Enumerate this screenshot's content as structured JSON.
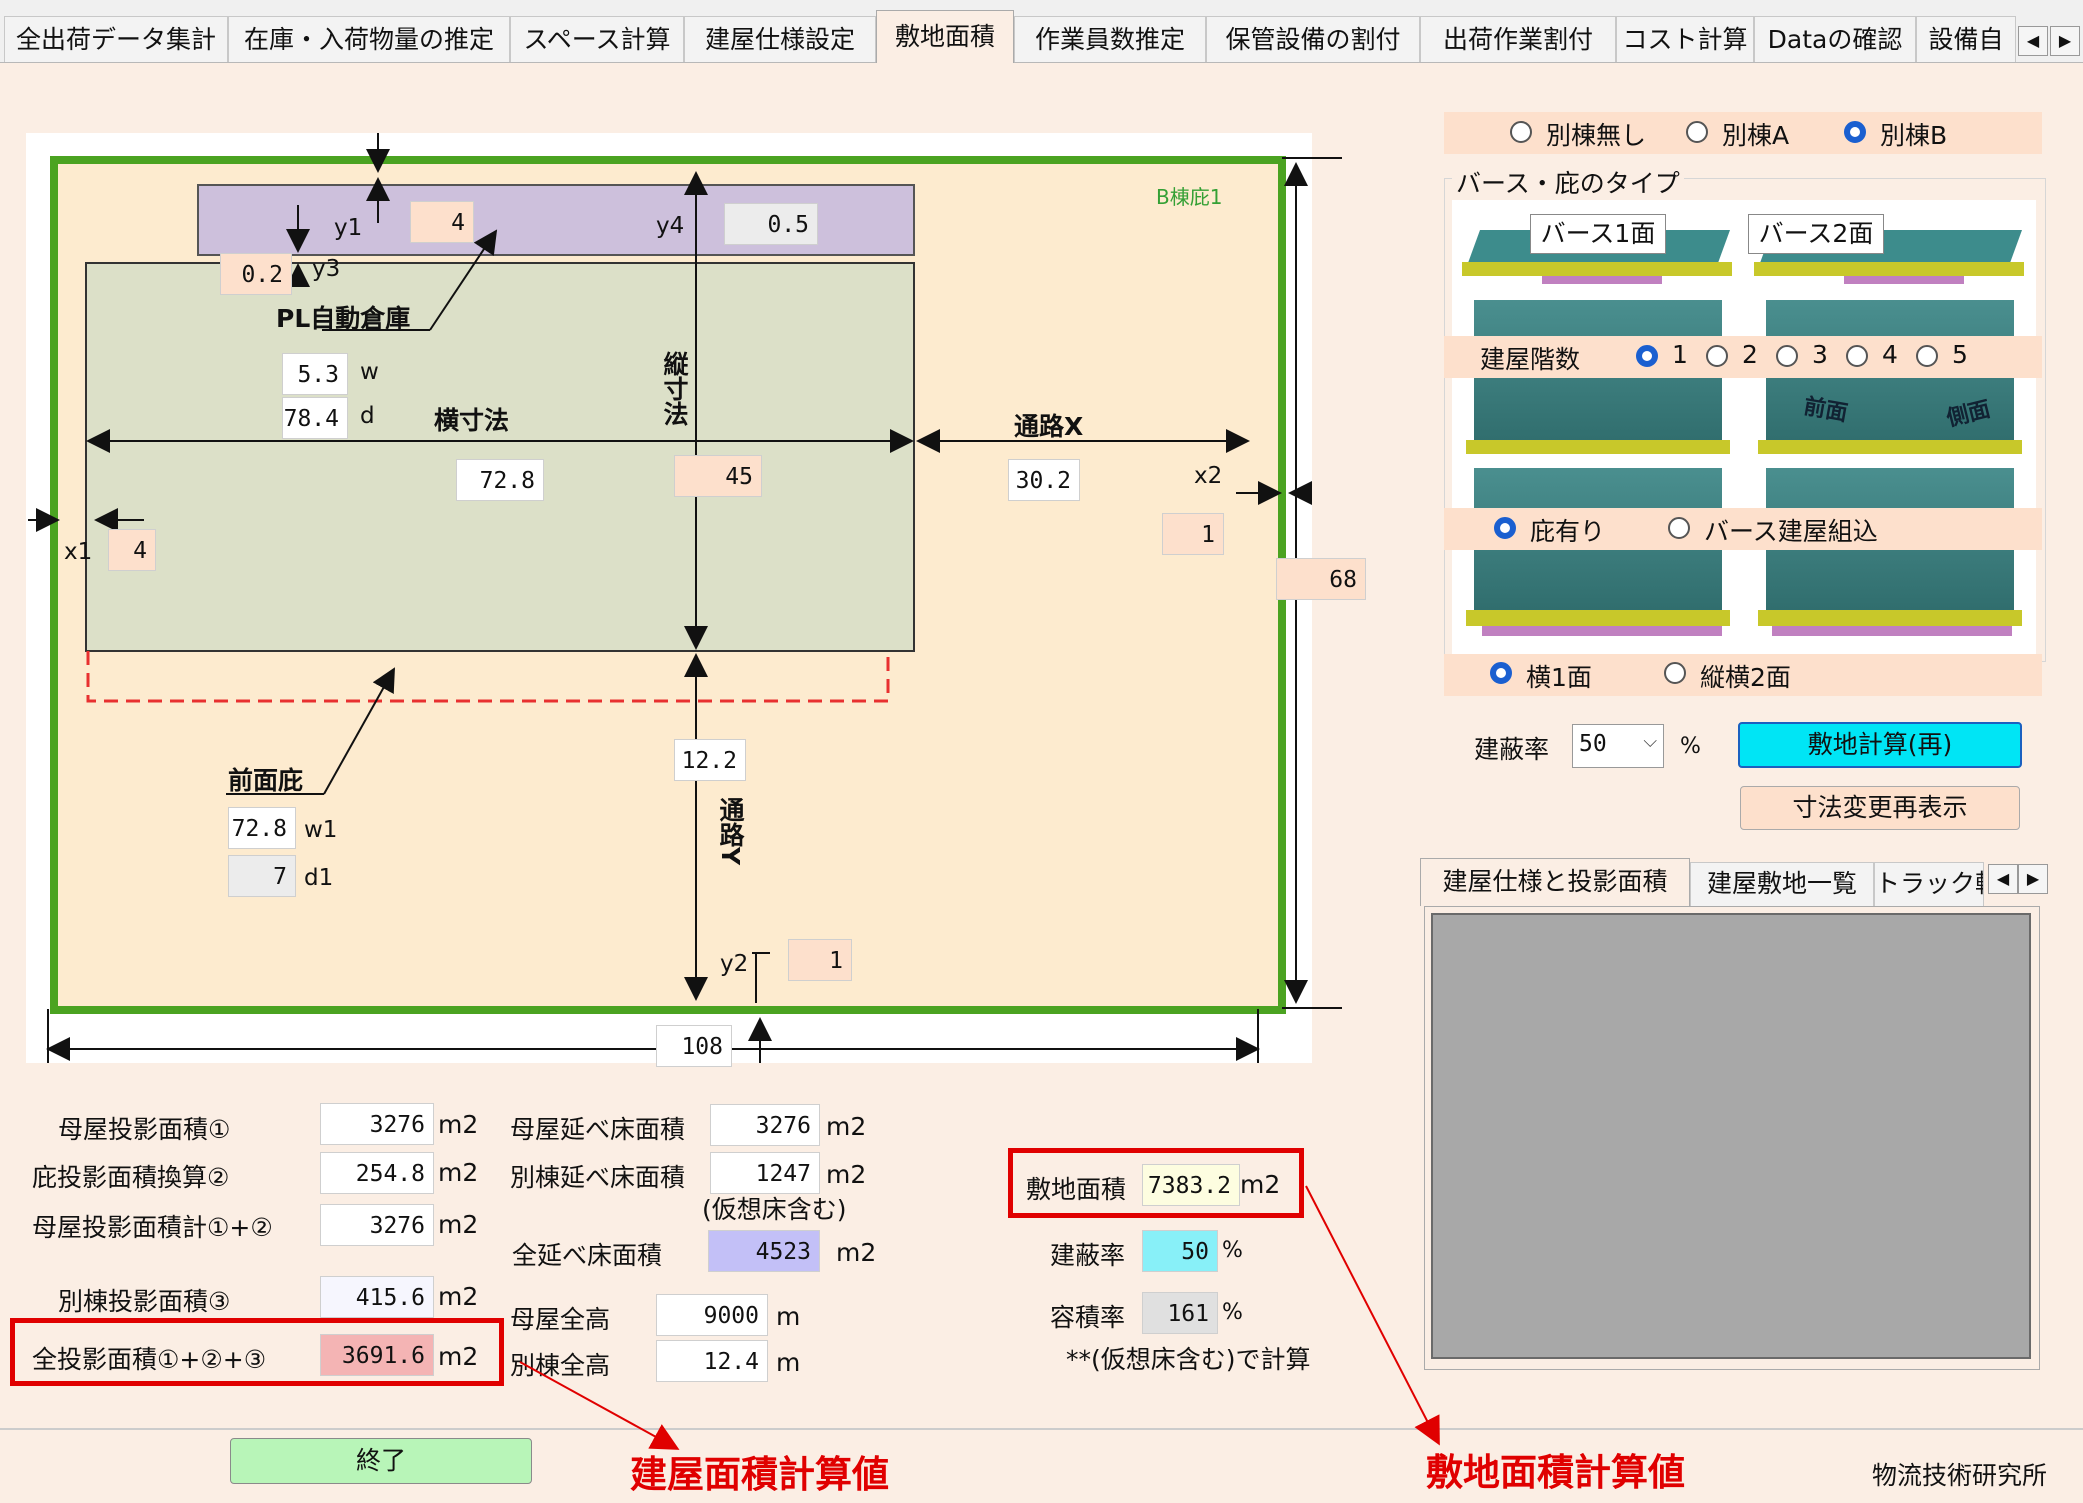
{
  "tabs": [
    "全出荷データ集計",
    "在庫・入荷物量の推定",
    "スペース計算",
    "建屋仕様設定",
    "敷地面積",
    "作業員数推定",
    "保管設備の割付",
    "出荷作業割付",
    "コスト計算",
    "Dataの確認",
    "設備自"
  ],
  "diagram": {
    "corner_label": "B棟庇1",
    "y1": "y1",
    "y1_value": "4",
    "y3_value": "0.2",
    "y3": "y3",
    "y4": "y4",
    "y4_value": "0.5",
    "pl_label": "PL自動倉庫",
    "w_value": "5.3",
    "w": "w",
    "d_value": "78.4",
    "d": "d",
    "yoko_label": "横寸法",
    "tate_label": "縦寸法",
    "tsuro_x_label": "通路X",
    "yoko_value": "72.8",
    "tate_value": "45",
    "tsuro_x_value": "30.2",
    "x2": "x2",
    "x2_value": "1",
    "x1": "x1",
    "x1_value": "4",
    "height_value": "68",
    "front_label": "前面庇",
    "tsuro_y_value": "12.2",
    "tsuro_y_label": "通路Y",
    "w1_value": "72.8",
    "w1": "w1",
    "d1_value": "7",
    "d1": "d1",
    "y2": "y2",
    "y2_value": "1",
    "width_value": "108"
  },
  "right": {
    "bettou_options": [
      "別棟無し",
      "別棟A",
      "別棟B"
    ],
    "berth_group_label": "バース・庇のタイプ",
    "berth1": "バース1面",
    "berth2": "バース2面",
    "floors_label": "建屋階数",
    "floor_options": [
      "1",
      "2",
      "3",
      "4",
      "5"
    ],
    "front_face": "前面",
    "side_face": "側面",
    "hisashi_options": [
      "庇有り",
      "バース建屋組込"
    ],
    "face_options": [
      "横1面",
      "縦横2面"
    ],
    "kenpei_label": "建蔽率",
    "kenpei_value": "50",
    "percent": "%",
    "calc_button": "敷地計算(再)",
    "redisplay_button": "寸法変更再表示",
    "subtabs": [
      "建屋仕様と投影面積",
      "建屋敷地一覧",
      "トラック軌"
    ]
  },
  "results": {
    "r1_label": "母屋投影面積①",
    "r1_value": "3276",
    "r2_label": "庇投影面積換算②",
    "r2_value": "254.8",
    "r3_label": "母屋投影面積計①+②",
    "r3_value": "3276",
    "r4_label": "別棟投影面積③",
    "r4_value": "415.6",
    "r5_label": "全投影面積①+②+③",
    "r5_value": "3691.6",
    "m1_label": "母屋延べ床面積",
    "m1_value": "3276",
    "m2_label": "別棟延べ床面積",
    "m2_value": "1247",
    "m2_note": "(仮想床含む)",
    "m3_label": "全延べ床面積",
    "m3_value": "4523",
    "m4_label": "母屋全高",
    "m4_value": "9000",
    "m5_label": "別棟全高",
    "m5_value": "12.4",
    "site_label": "敷地面積",
    "site_value": "7383.2",
    "kenpei_label": "建蔽率",
    "kenpei_value": "50",
    "youseki_label": "容積率",
    "youseki_value": "161",
    "note": "**(仮想床含む)で計算",
    "unit_m2": "m2",
    "unit_m": "m",
    "unit_pct": "%"
  },
  "footer": {
    "end_button": "終了",
    "annot_building": "建屋面積計算値",
    "annot_site": "敷地面積計算値",
    "company": "物流技術研究所"
  },
  "colors": {
    "annotation_red": "#e00000",
    "calc_button_bg": "#00e5f5",
    "end_button_bg": "#b8f5b8",
    "pink_field": "#fde0cc",
    "site_bg": "#fdebcf",
    "building_bg": "#dce0c8",
    "annex_bg": "#cdc0dc"
  }
}
